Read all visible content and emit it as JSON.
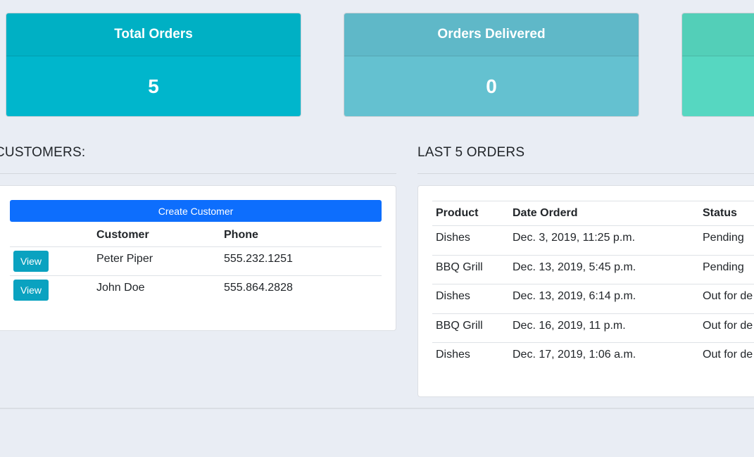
{
  "stats": {
    "total_orders": {
      "label": "Total Orders",
      "value": "5"
    },
    "orders_delivered": {
      "label": "Orders Delivered",
      "value": "0"
    }
  },
  "customers": {
    "title": "CUSTOMERS:",
    "create_label": "Create Customer",
    "columns": [
      "",
      "Customer",
      "Phone"
    ],
    "view_label": "View",
    "rows": [
      {
        "name": "Peter Piper",
        "phone": "555.232.1251"
      },
      {
        "name": "John Doe",
        "phone": "555.864.2828"
      }
    ]
  },
  "orders": {
    "title": "LAST 5 ORDERS",
    "columns": [
      "Product",
      "Date Orderd",
      "Status"
    ],
    "rows": [
      {
        "product": "Dishes",
        "date": "Dec. 3, 2019, 11:25 p.m.",
        "status": "Pending"
      },
      {
        "product": "BBQ Grill",
        "date": "Dec. 13, 2019, 5:45 p.m.",
        "status": "Pending"
      },
      {
        "product": "Dishes",
        "date": "Dec. 13, 2019, 6:14 p.m.",
        "status": "Out for de"
      },
      {
        "product": "BBQ Grill",
        "date": "Dec. 16, 2019, 11 p.m.",
        "status": "Out for de"
      },
      {
        "product": "Dishes",
        "date": "Dec. 17, 2019, 1:06 a.m.",
        "status": "Out for de"
      }
    ]
  },
  "colors": {
    "background": "#e9edf4",
    "total_orders_card": "#00b6cc",
    "orders_delivered_card": "#64c1d0",
    "third_card": "#56d7c1",
    "primary_button": "#0d6efd",
    "view_button": "#0aa2c0"
  }
}
